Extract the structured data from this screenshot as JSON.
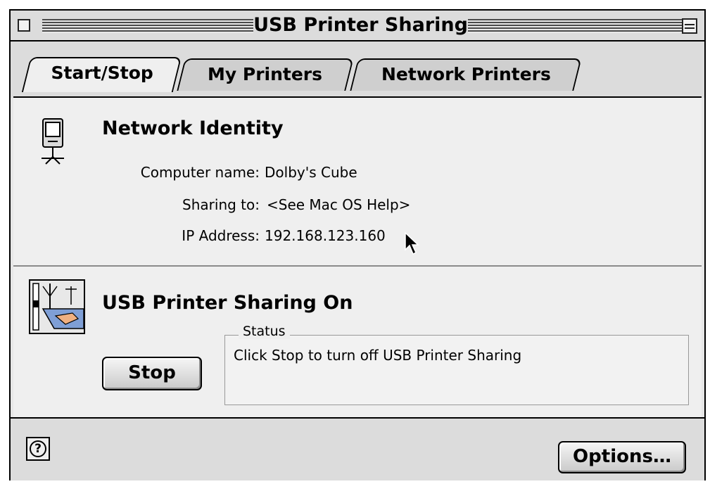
{
  "window": {
    "title": "USB Printer Sharing"
  },
  "tabs": [
    {
      "label": "Start/Stop",
      "active": true
    },
    {
      "label": "My Printers",
      "active": false
    },
    {
      "label": "Network Printers",
      "active": false
    }
  ],
  "network_identity": {
    "heading": "Network Identity",
    "fields": [
      {
        "label": "Computer name:",
        "value": "Dolby's Cube"
      },
      {
        "label": "Sharing to:",
        "value": "<See Mac OS Help>"
      },
      {
        "label": "IP Address:",
        "value": "192.168.123.160"
      }
    ]
  },
  "sharing": {
    "heading": "USB Printer Sharing On",
    "stop_label": "Stop",
    "status_legend": "Status",
    "status_text": "Click Stop to turn off USB Printer Sharing"
  },
  "footer": {
    "help_glyph": "?",
    "options_label": "Options…"
  },
  "icons": [
    "close-box-icon",
    "zoom-box-icon",
    "computer-icon",
    "control-panel-icon",
    "help-icon",
    "arrow-cursor-icon"
  ]
}
